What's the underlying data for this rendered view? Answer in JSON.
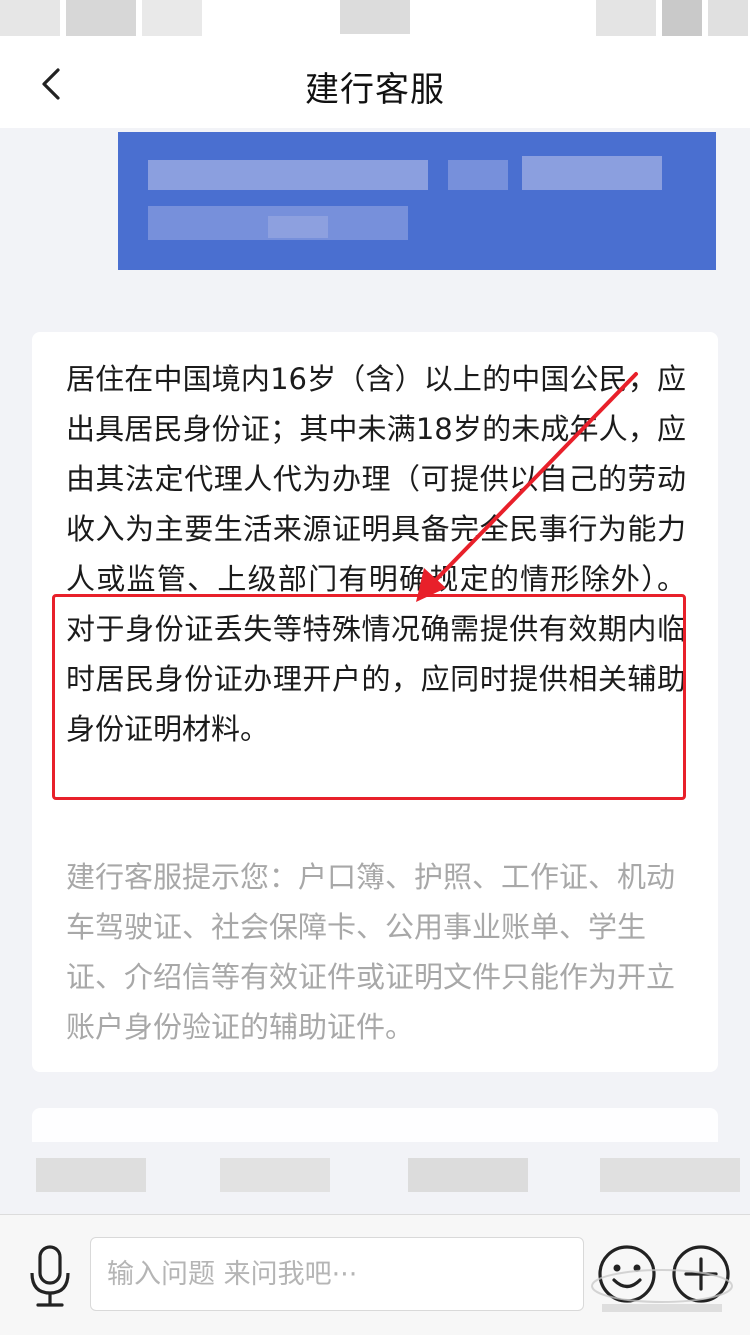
{
  "header": {
    "title": "建行客服",
    "back_icon": "chevron-left-icon"
  },
  "answer": {
    "text": "居住在中国境内16岁（含）以上的中国公民，应出具居民身份证；其中未满18岁的未成年人，应由其法定代理人代为办理（可提供以自己的劳动收入为主要生活来源证明具备完全民事行为能力人或监管、上级部门有明确规定的情形除外）。对于身份证丢失等特殊情况确需提供有效期内临时居民身份证办理开户的，应同时提供相关辅助身份证明材料。",
    "hint": "建行客服提示您：户口簿、护照、工作证、机动车驾驶证、社会保障卡、公用事业账单、学生证、介绍信等有效证件或证明文件只能作为开立账户身份验证的辅助证件。"
  },
  "input_bar": {
    "placeholder": "输入问题 来问我吧···",
    "mic_icon": "microphone-icon",
    "emoji_icon": "emoji-icon",
    "plus_icon": "plus-circle-icon"
  },
  "colors": {
    "user_bubble": "#4a6fd0",
    "highlight": "#e8202a",
    "hint_text": "#a8a8a8"
  }
}
